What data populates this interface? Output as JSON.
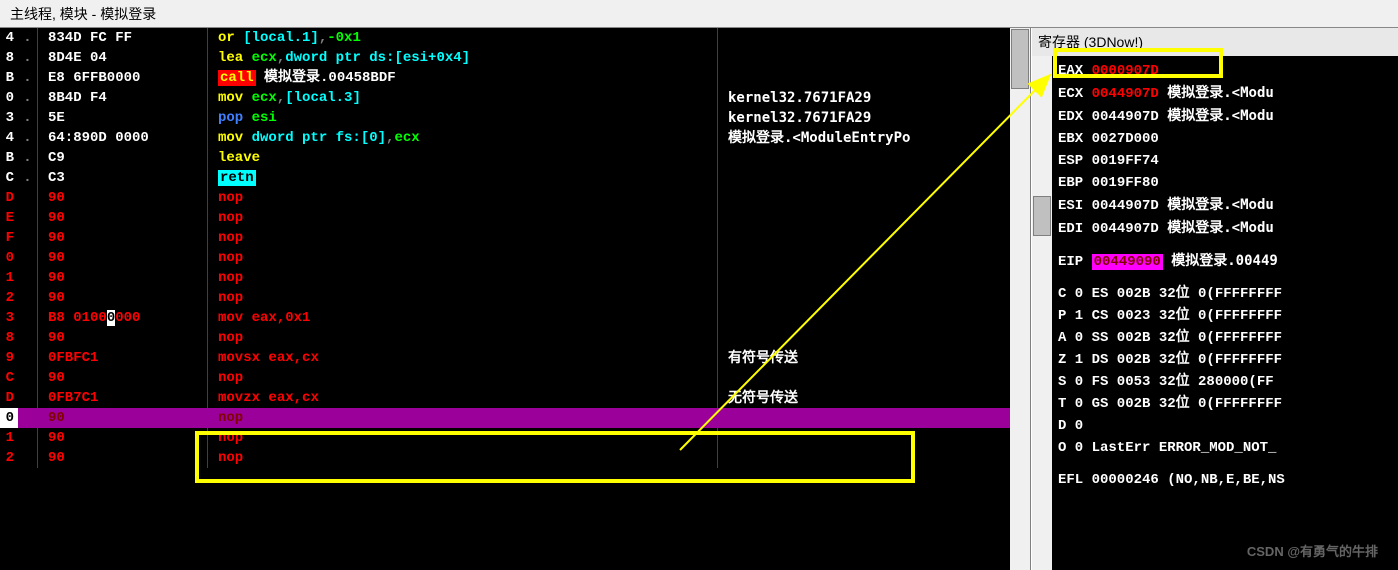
{
  "window": {
    "title": "主线程, 模块 - 模拟登录"
  },
  "disasm": {
    "rows": [
      {
        "addr": "4",
        "mark": ".",
        "bytes": "834D FC FF",
        "parts": [
          {
            "t": "or ",
            "c": "yellow"
          },
          {
            "t": "[local.1]",
            "c": "cyan"
          },
          {
            "t": ",",
            "c": "grey"
          },
          {
            "t": "-0x1",
            "c": "green"
          }
        ],
        "comment": ""
      },
      {
        "addr": "8",
        "mark": ".",
        "bytes": "8D4E 04",
        "parts": [
          {
            "t": "lea ",
            "c": "yellow"
          },
          {
            "t": "ecx",
            "c": "green"
          },
          {
            "t": ",",
            "c": "grey"
          },
          {
            "t": "dword ptr ds:[esi+0x4]",
            "c": "cyan"
          }
        ],
        "comment": ""
      },
      {
        "addr": "B",
        "mark": ".",
        "bytes": "E8 6FFB0000",
        "parts": [
          {
            "t": "call",
            "c": "yellow",
            "bg": "red"
          },
          {
            "t": " ",
            "c": "white"
          },
          {
            "t": "模拟登录.00458BDF",
            "c": "white"
          }
        ],
        "comment": ""
      },
      {
        "addr": "0",
        "mark": ".",
        "bytes": "8B4D F4",
        "parts": [
          {
            "t": "mov ",
            "c": "yellow"
          },
          {
            "t": "ecx",
            "c": "green"
          },
          {
            "t": ",",
            "c": "grey"
          },
          {
            "t": "[local.3]",
            "c": "cyan"
          }
        ],
        "comment": "kernel32.7671FA29"
      },
      {
        "addr": "3",
        "mark": ".",
        "bytes": "5E",
        "parts": [
          {
            "t": "pop ",
            "c": "blue"
          },
          {
            "t": "esi",
            "c": "green"
          }
        ],
        "comment": "kernel32.7671FA29"
      },
      {
        "addr": "4",
        "mark": ".",
        "bytes": "64:890D 0000",
        "parts": [
          {
            "t": "mov ",
            "c": "yellow"
          },
          {
            "t": "dword ptr fs:[0]",
            "c": "cyan"
          },
          {
            "t": ",",
            "c": "grey"
          },
          {
            "t": "ecx",
            "c": "green"
          }
        ],
        "comment": "模拟登录.<ModuleEntryPo"
      },
      {
        "addr": "B",
        "mark": ".",
        "bytes": "C9",
        "parts": [
          {
            "t": "leave",
            "c": "yellow"
          }
        ],
        "comment": ""
      },
      {
        "addr": "C",
        "mark": ".",
        "bytes": "C3",
        "parts": [
          {
            "t": "retn",
            "c": "black",
            "bg": "cyan"
          }
        ],
        "comment": ""
      },
      {
        "addr": "D",
        "mark": "",
        "bytes": "90",
        "bytesClr": "red",
        "parts": [
          {
            "t": "nop",
            "c": "red"
          }
        ],
        "comment": ""
      },
      {
        "addr": "E",
        "mark": "",
        "bytes": "90",
        "bytesClr": "red",
        "parts": [
          {
            "t": "nop",
            "c": "red"
          }
        ],
        "comment": ""
      },
      {
        "addr": "F",
        "mark": "",
        "bytes": "90",
        "bytesClr": "red",
        "parts": [
          {
            "t": "nop",
            "c": "red"
          }
        ],
        "comment": ""
      },
      {
        "addr": "0",
        "mark": "",
        "bytes": "90",
        "bytesClr": "red",
        "parts": [
          {
            "t": "nop",
            "c": "red"
          }
        ],
        "comment": ""
      },
      {
        "addr": "1",
        "mark": "",
        "bytes": "90",
        "bytesClr": "red",
        "parts": [
          {
            "t": "nop",
            "c": "red"
          }
        ],
        "comment": ""
      },
      {
        "addr": "2",
        "mark": "",
        "bytes": "90",
        "bytesClr": "red",
        "parts": [
          {
            "t": "nop",
            "c": "red"
          }
        ],
        "comment": ""
      },
      {
        "addr": "3",
        "mark": "",
        "bytes": "B8 0100",
        "bytesClr": "red",
        "bytesTail": "0",
        "bytesTailBg": "white",
        "bytesTail2": "000",
        "parts": [
          {
            "t": "mov ",
            "c": "red"
          },
          {
            "t": "eax",
            "c": "red"
          },
          {
            "t": ",",
            "c": "red"
          },
          {
            "t": "0x1",
            "c": "red"
          }
        ],
        "comment": ""
      },
      {
        "addr": "8",
        "mark": "",
        "bytes": "90",
        "bytesClr": "red",
        "parts": [
          {
            "t": "nop",
            "c": "red"
          }
        ],
        "comment": ""
      },
      {
        "addr": "9",
        "mark": "",
        "bytes": "0FBFC1",
        "bytesClr": "red",
        "parts": [
          {
            "t": "movsx ",
            "c": "red"
          },
          {
            "t": "eax",
            "c": "red"
          },
          {
            "t": ",",
            "c": "red"
          },
          {
            "t": "cx",
            "c": "red"
          }
        ],
        "comment": "有符号传送"
      },
      {
        "addr": "C",
        "mark": "",
        "bytes": "90",
        "bytesClr": "red",
        "parts": [
          {
            "t": "nop",
            "c": "red"
          }
        ],
        "comment": ""
      },
      {
        "addr": "D",
        "mark": "",
        "bytes": "0FB7C1",
        "bytesClr": "red",
        "parts": [
          {
            "t": "movzx ",
            "c": "red"
          },
          {
            "t": "eax",
            "c": "red"
          },
          {
            "t": ",",
            "c": "red"
          },
          {
            "t": "cx",
            "c": "red"
          }
        ],
        "comment": "无符号传送"
      },
      {
        "addr": "0",
        "mark": "",
        "bytes": "90",
        "bytesClr": "darkred",
        "parts": [
          {
            "t": "nop",
            "c": "darkred"
          }
        ],
        "comment": "",
        "highlight": true
      },
      {
        "addr": "1",
        "mark": "",
        "bytes": "90",
        "bytesClr": "red",
        "parts": [
          {
            "t": "nop",
            "c": "red"
          }
        ],
        "comment": ""
      },
      {
        "addr": "2",
        "mark": "",
        "bytes": "90",
        "bytesClr": "red",
        "parts": [
          {
            "t": "nop",
            "c": "red"
          }
        ],
        "comment": ""
      }
    ]
  },
  "registers": {
    "header": "寄存器 (3DNow!)",
    "items": [
      {
        "name": "EAX",
        "value": "0000907D",
        "valClr": "red"
      },
      {
        "name": "ECX",
        "value": "0044907D",
        "valClr": "red",
        "extra": "模拟登录.<Modu"
      },
      {
        "name": "EDX",
        "value": "0044907D",
        "extra": "模拟登录.<Modu"
      },
      {
        "name": "EBX",
        "value": "0027D000"
      },
      {
        "name": "ESP",
        "value": "0019FF74"
      },
      {
        "name": "EBP",
        "value": "0019FF80"
      },
      {
        "name": "ESI",
        "value": "0044907D",
        "extra": "模拟登录.<Modu"
      },
      {
        "name": "EDI",
        "value": "0044907D",
        "extra": "模拟登录.<Modu"
      }
    ],
    "eip": {
      "name": "EIP",
      "value": "00449090",
      "extra": "模拟登录.00449"
    },
    "flags": [
      {
        "f": "C",
        "v": "0",
        "seg": "ES",
        "sv": "002B",
        "bits": "32位",
        "rest": "0(FFFFFFFF"
      },
      {
        "f": "P",
        "v": "1",
        "seg": "CS",
        "sv": "0023",
        "bits": "32位",
        "rest": "0(FFFFFFFF"
      },
      {
        "f": "A",
        "v": "0",
        "seg": "SS",
        "sv": "002B",
        "bits": "32位",
        "rest": "0(FFFFFFFF"
      },
      {
        "f": "Z",
        "v": "1",
        "seg": "DS",
        "sv": "002B",
        "bits": "32位",
        "rest": "0(FFFFFFFF"
      },
      {
        "f": "S",
        "v": "0",
        "seg": "FS",
        "sv": "0053",
        "bits": "32位",
        "rest": "280000(FF"
      },
      {
        "f": "T",
        "v": "0",
        "seg": "GS",
        "sv": "002B",
        "bits": "32位",
        "rest": "0(FFFFFFFF"
      },
      {
        "f": "D",
        "v": "0"
      },
      {
        "f": "O",
        "v": "0",
        "seg": "",
        "sv": "LastErr",
        "bits": "",
        "rest": "ERROR_MOD_NOT_"
      }
    ],
    "efl": {
      "name": "EFL",
      "value": "00000246",
      "extra": "(NO,NB,E,BE,NS"
    }
  },
  "watermark": "CSDN @有勇气的牛排"
}
